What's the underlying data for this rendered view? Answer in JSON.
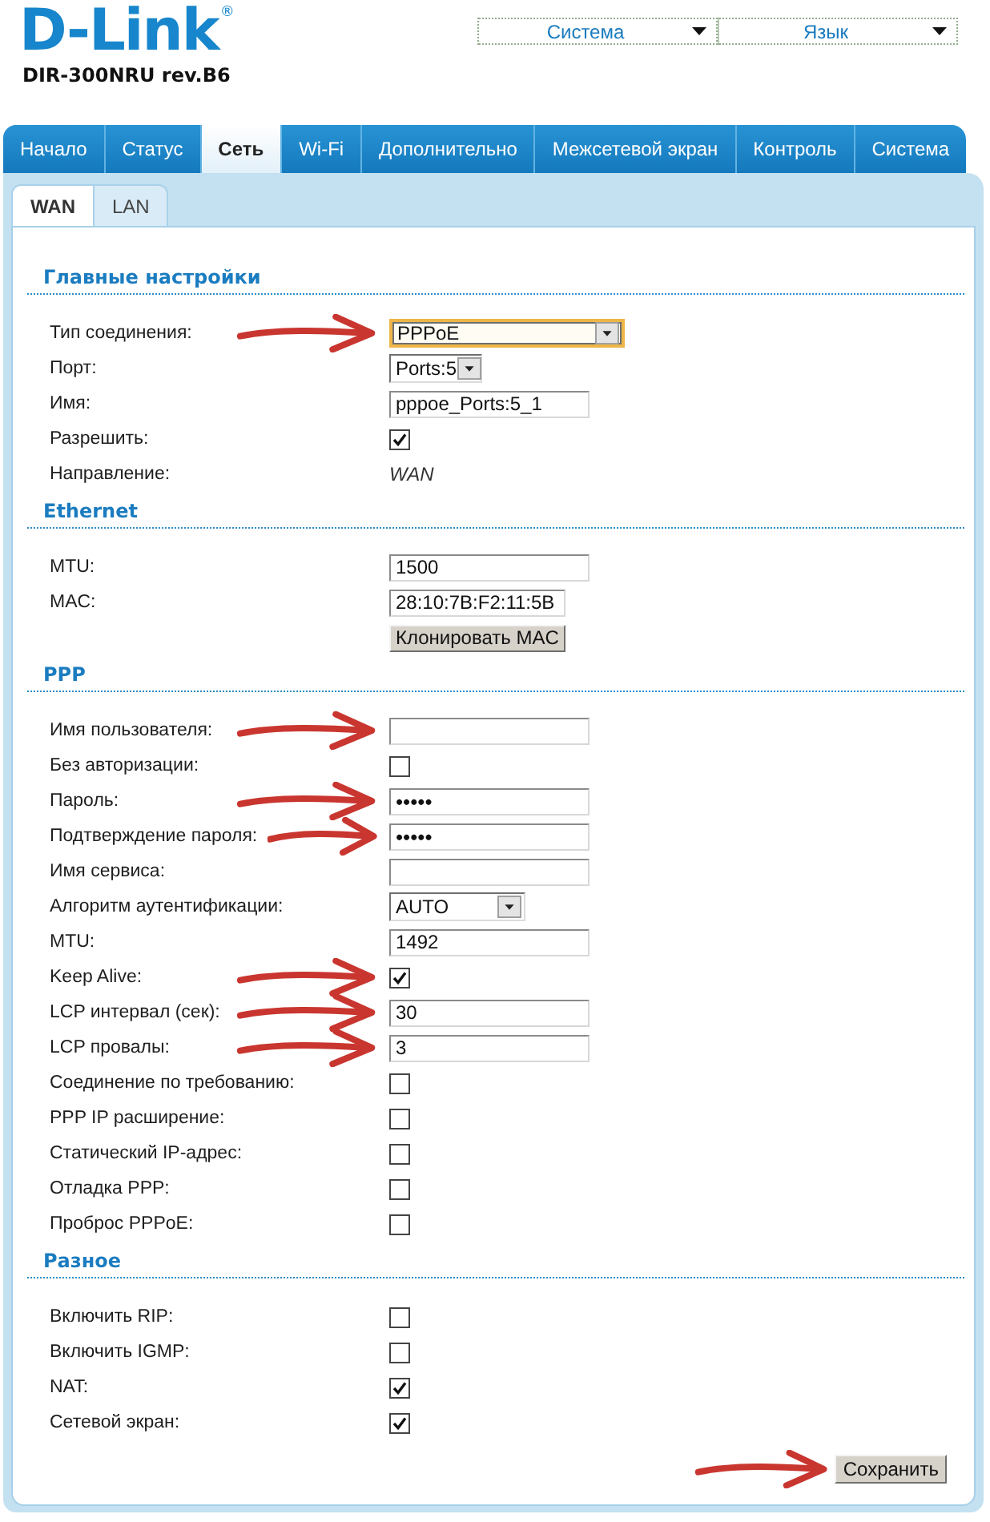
{
  "header": {
    "logo": "D-Link$^{®}$",
    "model": "DIR-300NRU rev.B6",
    "menus": [
      {
        "label": "Система"
      },
      {
        "label": "Язык"
      }
    ]
  },
  "tabs": [
    {
      "label": "Начало",
      "selected": false
    },
    {
      "label": "Статус",
      "selected": false
    },
    {
      "label": "Сеть",
      "selected": true
    },
    {
      "label": "Wi-Fi",
      "selected": false
    },
    {
      "label": "Дополнительно",
      "selected": false
    },
    {
      "label": "Межсетевой экран",
      "selected": false
    },
    {
      "label": "Контроль",
      "selected": false
    },
    {
      "label": "Система",
      "selected": false
    }
  ],
  "subtabs": [
    {
      "label": "WAN",
      "selected": true
    },
    {
      "label": "LAN",
      "selected": false
    }
  ],
  "sections": [
    {
      "title": "Главные настройки",
      "rows": [
        {
          "kind": "select",
          "label": "Тип соединения:",
          "value": "PPPoE",
          "focused": true,
          "arrow": true
        },
        {
          "kind": "select",
          "label": "Порт:",
          "value": "Ports:5",
          "focused": false,
          "arrow": false
        },
        {
          "kind": "input",
          "label": "Имя:",
          "value": "pppoe_Ports:5_1",
          "focused": false,
          "arrow": false
        },
        {
          "kind": "checkbox",
          "label": "Разрешить:",
          "checked": true,
          "focused": false,
          "arrow": false
        },
        {
          "kind": "text",
          "label": "Направление:",
          "value": "WAN",
          "focused": false,
          "arrow": false
        }
      ]
    },
    {
      "title": "Ethernet",
      "rows": [
        {
          "kind": "input",
          "label": "MTU:",
          "value": "1500",
          "focused": false,
          "arrow": false
        },
        {
          "kind": "input",
          "label": "MAC:",
          "value": "28:10:7B:F2:11:5B",
          "focused": false,
          "arrow": false
        },
        {
          "kind": "button",
          "text": "Клонировать MAC",
          "focused": false,
          "arrow": false
        }
      ]
    },
    {
      "title": "PPP",
      "rows": [
        {
          "kind": "input",
          "label": "Имя пользователя:",
          "focused": false,
          "arrow": true
        },
        {
          "kind": "checkbox",
          "label": "Без авторизации:",
          "checked": false,
          "focused": false,
          "arrow": false
        },
        {
          "kind": "password",
          "label": "Пароль:",
          "value": "•••••",
          "focused": false,
          "arrow": true
        },
        {
          "kind": "password",
          "label": "Подтверждение пароля:",
          "value": "•••••",
          "focused": false,
          "arrow": true
        },
        {
          "kind": "input",
          "label": "Имя сервиса:",
          "focused": false,
          "arrow": false
        },
        {
          "kind": "select",
          "label": "Алгоритм аутентификации:",
          "value": "AUTO",
          "focused": false,
          "arrow": false
        },
        {
          "kind": "input",
          "label": "MTU:",
          "value": "1492",
          "focused": false,
          "arrow": false
        },
        {
          "kind": "checkbox",
          "label": "Keep Alive:",
          "checked": true,
          "focused": false,
          "arrow": true
        },
        {
          "kind": "input",
          "label": "LCP интервал (сек):",
          "value": "30",
          "focused": false,
          "arrow": true
        },
        {
          "kind": "input",
          "label": "LCP провалы:",
          "value": "3",
          "focused": false,
          "arrow": true
        },
        {
          "kind": "checkbox",
          "label": "Соединение по требованию:",
          "checked": false,
          "focused": false,
          "arrow": false
        },
        {
          "kind": "checkbox",
          "label": "PPP IP расширение:",
          "checked": false,
          "focused": false,
          "arrow": false
        },
        {
          "kind": "checkbox",
          "label": "Статический IP-адрес:",
          "checked": false,
          "focused": false,
          "arrow": false
        },
        {
          "kind": "checkbox",
          "label": "Отладка PPP:",
          "checked": false,
          "focused": false,
          "arrow": false
        },
        {
          "kind": "checkbox",
          "label": "Проброс PPPoE:",
          "checked": false,
          "focused": false,
          "arrow": false
        }
      ]
    },
    {
      "title": "Разное",
      "rows": [
        {
          "kind": "checkbox",
          "label": "Включить RIP:",
          "checked": false,
          "focused": false,
          "arrow": false
        },
        {
          "kind": "checkbox",
          "label": "Включить IGMP:",
          "checked": false,
          "focused": false,
          "arrow": false
        },
        {
          "kind": "checkbox",
          "label": "NAT:",
          "checked": true,
          "focused": false,
          "arrow": false
        },
        {
          "kind": "checkbox",
          "label": "Сетевой экран:",
          "checked": true,
          "focused": false,
          "arrow": false
        }
      ]
    }
  ],
  "save_button": {
    "label": "Сохранить",
    "arrow": true
  }
}
